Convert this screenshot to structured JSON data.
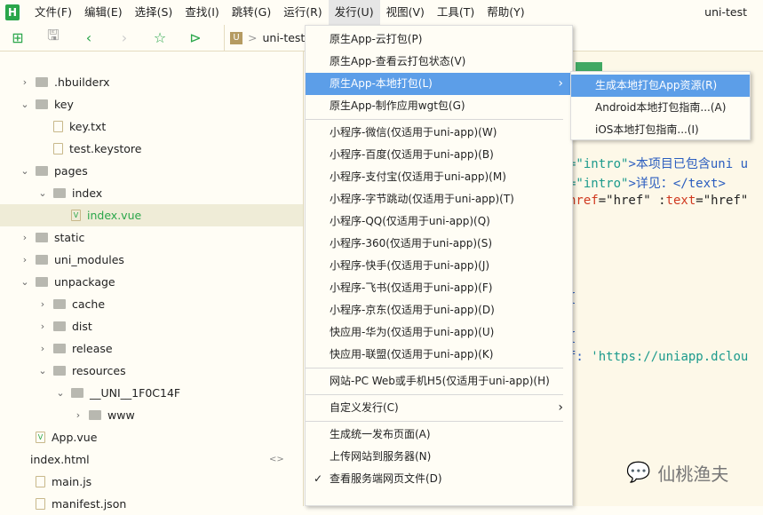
{
  "menubar": {
    "logo": "H",
    "items": [
      "文件(F)",
      "编辑(E)",
      "选择(S)",
      "查找(I)",
      "跳转(G)",
      "运行(R)",
      "发行(U)",
      "视图(V)",
      "工具(T)",
      "帮助(Y)"
    ],
    "window_title": "uni-test"
  },
  "toolbar": {
    "crumb_icon": "U",
    "crumb_sep": ">",
    "project": "uni-test"
  },
  "tree": [
    {
      "label": ".hbuilderx",
      "level": 0,
      "type": "folder",
      "expanded": false
    },
    {
      "label": "key",
      "level": 0,
      "type": "folder",
      "expanded": true
    },
    {
      "label": "key.txt",
      "level": 1,
      "type": "file"
    },
    {
      "label": "test.keystore",
      "level": 1,
      "type": "file"
    },
    {
      "label": "pages",
      "level": 0,
      "type": "folder",
      "expanded": true
    },
    {
      "label": "index",
      "level": 1,
      "type": "folder",
      "expanded": true
    },
    {
      "label": "index.vue",
      "level": 2,
      "type": "vue",
      "selected": true
    },
    {
      "label": "static",
      "level": 0,
      "type": "folder",
      "expanded": false
    },
    {
      "label": "uni_modules",
      "level": 0,
      "type": "folder",
      "expanded": false
    },
    {
      "label": "unpackage",
      "level": 0,
      "type": "folder",
      "expanded": true
    },
    {
      "label": "cache",
      "level": 1,
      "type": "folder",
      "expanded": false
    },
    {
      "label": "dist",
      "level": 1,
      "type": "folder",
      "expanded": false
    },
    {
      "label": "release",
      "level": 1,
      "type": "folder",
      "expanded": false
    },
    {
      "label": "resources",
      "level": 1,
      "type": "folder",
      "expanded": true
    },
    {
      "label": "__UNI__1F0C14F",
      "level": 2,
      "type": "folder",
      "expanded": true
    },
    {
      "label": "www",
      "level": 3,
      "type": "folder",
      "expanded": false
    },
    {
      "label": "App.vue",
      "level": 0,
      "type": "vue"
    },
    {
      "label": "index.html",
      "level": 0,
      "type": "code"
    },
    {
      "label": "main.js",
      "level": 0,
      "type": "file"
    },
    {
      "label": "manifest.json",
      "level": 0,
      "type": "file"
    }
  ],
  "editor": {
    "line1a": "=\"intro\"",
    "line1b": ">本项目已包含uni u",
    "line2a": "=\"intro\"",
    "line2b": ">详见：",
    "line2c": "</text>",
    "line3a": "href",
    "line3b": "=\"href\" :",
    "line3c": "text",
    "line3d": "=\"href\"",
    "brace1": "{",
    "brace2": "{",
    "line4a": "f: ",
    "line4b": "'https://uniapp.dclou"
  },
  "menu": {
    "items": [
      {
        "label": "原生App-云打包(P)"
      },
      {
        "label": "原生App-查看云打包状态(V)"
      },
      {
        "label": "原生App-本地打包(L)",
        "highlighted": true,
        "submenu": true
      },
      {
        "label": "原生App-制作应用wgt包(G)"
      },
      {
        "sep": true
      },
      {
        "label": "小程序-微信(仅适用于uni-app)(W)"
      },
      {
        "label": "小程序-百度(仅适用于uni-app)(B)"
      },
      {
        "label": "小程序-支付宝(仅适用于uni-app)(M)"
      },
      {
        "label": "小程序-字节跳动(仅适用于uni-app)(T)"
      },
      {
        "label": "小程序-QQ(仅适用于uni-app)(Q)"
      },
      {
        "label": "小程序-360(仅适用于uni-app)(S)"
      },
      {
        "label": "小程序-快手(仅适用于uni-app)(J)"
      },
      {
        "label": "小程序-飞书(仅适用于uni-app)(F)"
      },
      {
        "label": "小程序-京东(仅适用于uni-app)(D)"
      },
      {
        "label": "快应用-华为(仅适用于uni-app)(U)"
      },
      {
        "label": "快应用-联盟(仅适用于uni-app)(K)"
      },
      {
        "sep": true
      },
      {
        "label": "网站-PC Web或手机H5(仅适用于uni-app)(H)"
      },
      {
        "sep": true
      },
      {
        "label": "自定义发行(C)",
        "submenu": true
      },
      {
        "sep": true
      },
      {
        "label": "生成统一发布页面(A)"
      },
      {
        "label": "上传网站到服务器(N)"
      },
      {
        "label": "查看服务端网页文件(D)",
        "checked": true
      }
    ]
  },
  "submenu": {
    "items": [
      {
        "label": "生成本地打包App资源(R)",
        "highlighted": true
      },
      {
        "label": "Android本地打包指南...(A)"
      },
      {
        "label": "iOS本地打包指南...(I)"
      }
    ]
  },
  "watermark": "仙桃渔夫",
  "colors": {
    "accent": "#2aa64a",
    "highlight": "#5c9ee8"
  }
}
